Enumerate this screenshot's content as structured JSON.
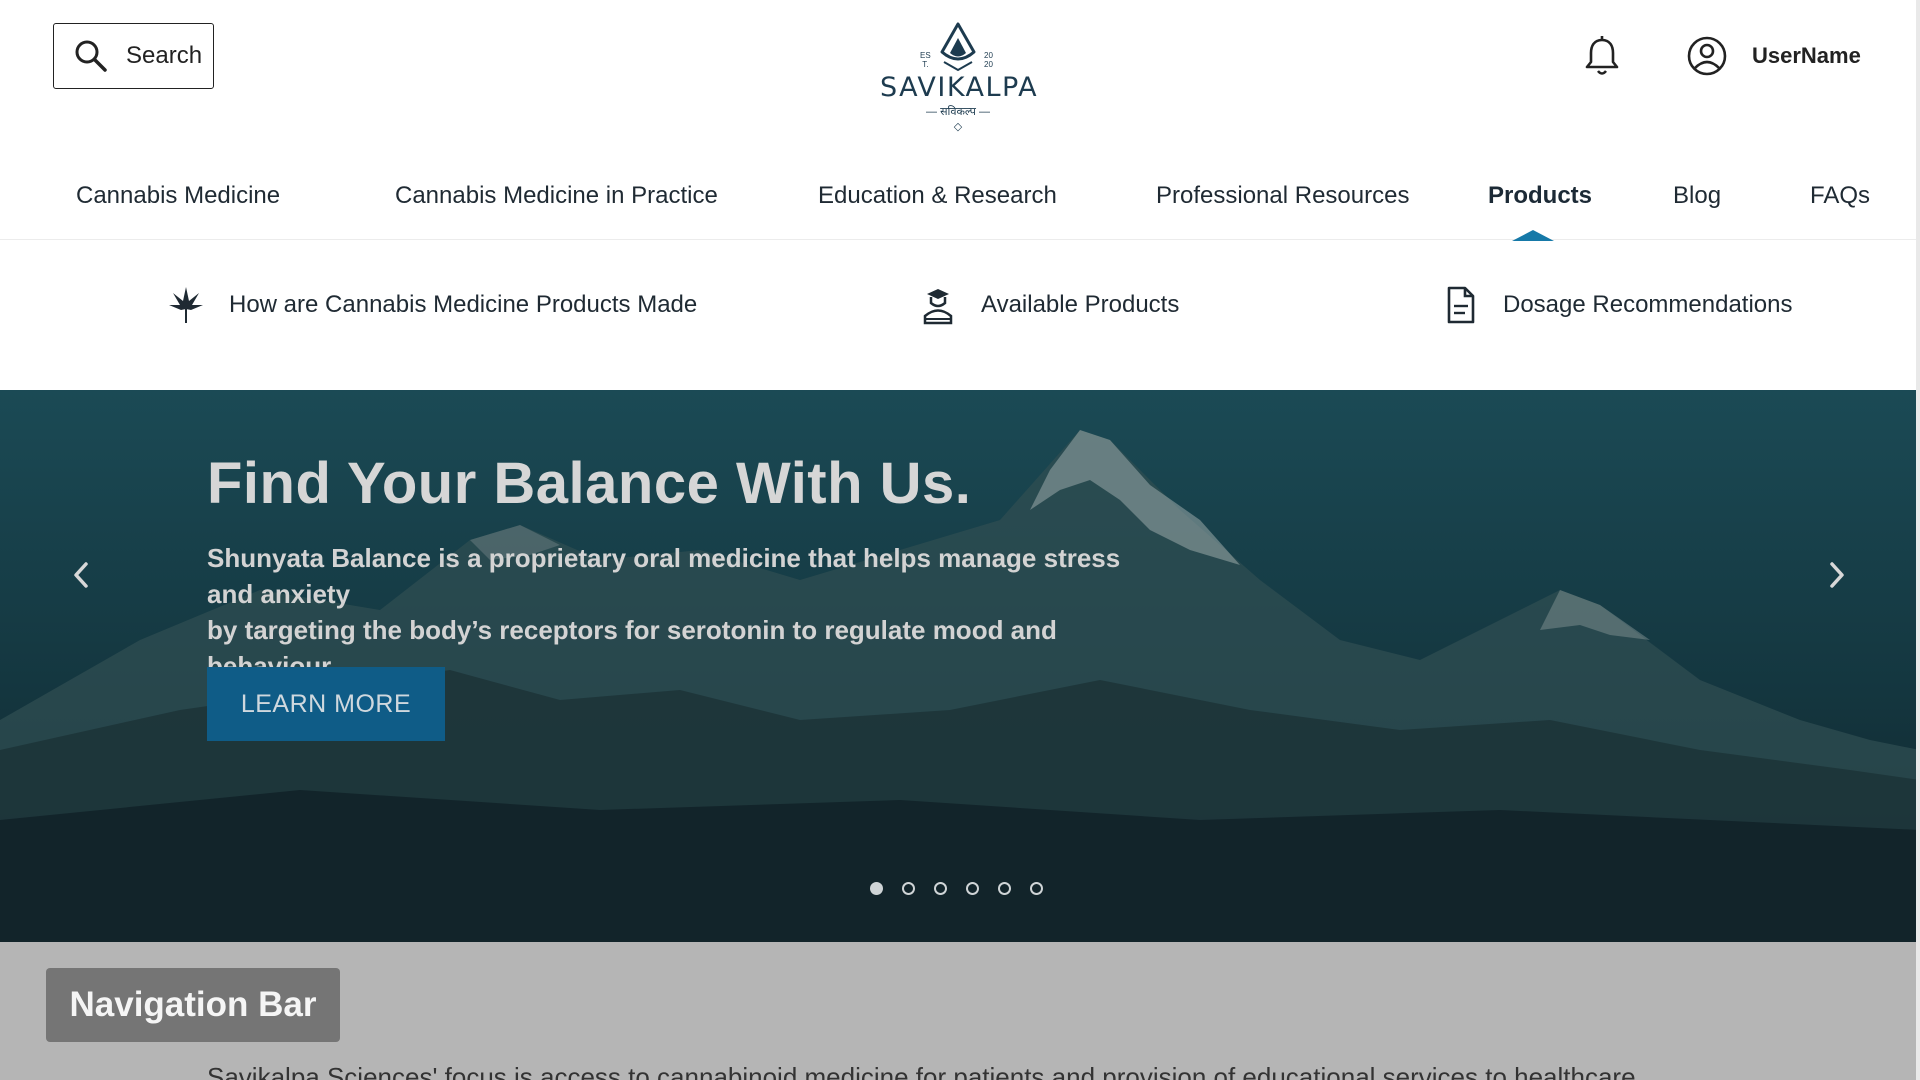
{
  "header": {
    "search_label": "Search",
    "logo": {
      "wordmark": "SAVIKALPA",
      "subtitle": "सविकल्प",
      "est_left": "ES\nT.",
      "est_right": "20\n20"
    },
    "username": "UserName"
  },
  "nav": {
    "items": [
      "Cannabis Medicine",
      "Cannabis Medicine in Practice",
      "Education & Research",
      "Professional Resources",
      "Products",
      "Blog",
      "FAQs"
    ],
    "active": "Products"
  },
  "subnav": {
    "items": [
      {
        "label": "How are Cannabis Medicine Products Made",
        "icon": "cannabis-leaf-icon"
      },
      {
        "label": "Available Products",
        "icon": "graduate-person-icon"
      },
      {
        "label": "Dosage Recommendations",
        "icon": "document-icon"
      }
    ]
  },
  "hero": {
    "title": "Find Your Balance With Us.",
    "description_line1": "Shunyata Balance is a proprietary oral medicine that helps manage stress and anxiety",
    "description_line2": "by targeting the body’s receptors for serotonin to regulate mood and behaviour.",
    "cta_label": "LEARN MORE",
    "slides_count": 6,
    "active_slide": 1
  },
  "section": {
    "tag_label": "Navigation Bar",
    "body_text": "Savikalpa Sciences' focus is access to cannabinoid medicine for patients and provision of educational services to healthcare"
  },
  "colors": {
    "accent": "#1679a8",
    "cta_bg": "#0f5c87",
    "hero_bg": "#173f49",
    "section_bg": "#b5b5b5",
    "tag_bg": "#757575",
    "logo": "#1d3b4f"
  }
}
